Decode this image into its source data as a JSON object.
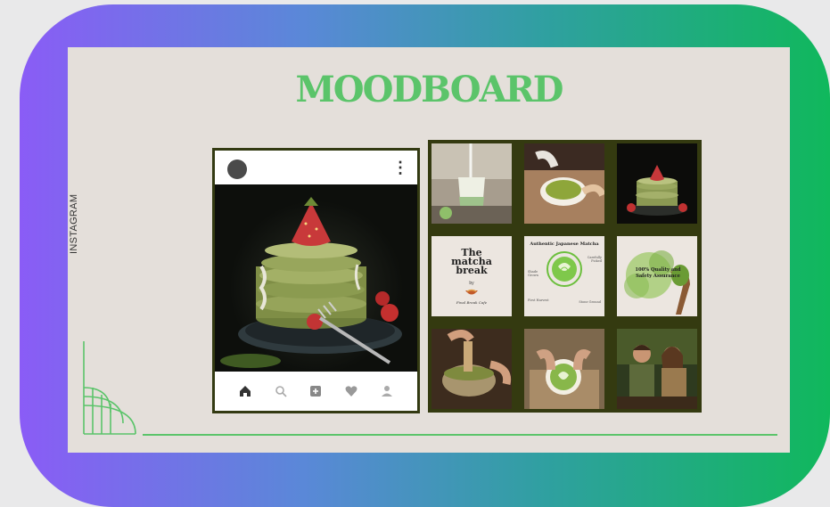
{
  "slide": {
    "title": "MOODBOARD",
    "side_label": "INSTAGRAM"
  },
  "phone": {
    "post_image": "matcha pancake stack with strawberry",
    "nav_icons": [
      "home-icon",
      "search-icon",
      "add-post-icon",
      "heart-icon",
      "profile-icon"
    ]
  },
  "grid": {
    "matcha_break": {
      "title_line1": "The",
      "title_line2": "matcha",
      "title_line3": "break",
      "by": "by",
      "signature": "Final Break Cafe"
    },
    "authentic": {
      "heading": "Authentic Japanese Matcha",
      "left_note": "Shade Grown",
      "right_note": "Carefully Picked",
      "bottom_left": "First Harvest",
      "bottom_right": "Stone Ground"
    },
    "quality": {
      "text": "100% Quality and Safety Assurance"
    }
  },
  "colors": {
    "accent_green": "#5bc46a",
    "frame_border": "#333a12",
    "slide_bg": "#e4dfda"
  }
}
